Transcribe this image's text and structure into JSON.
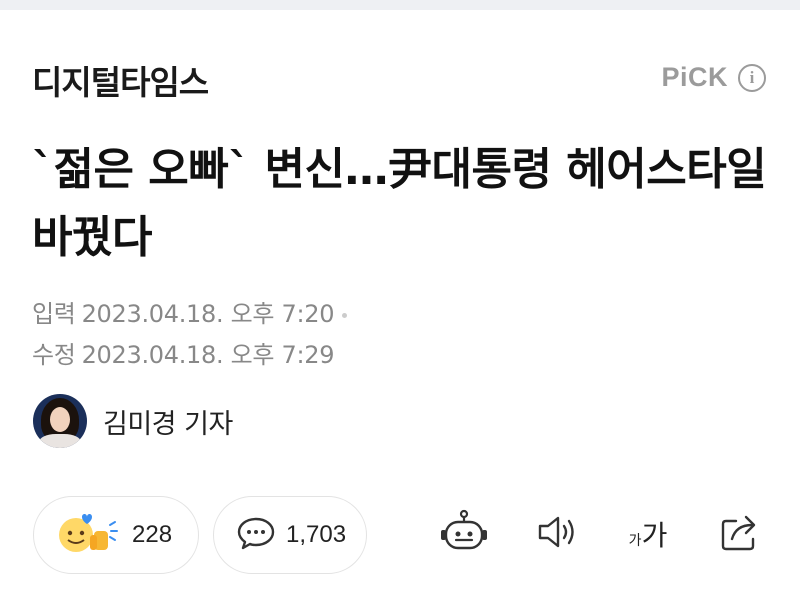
{
  "header": {
    "logo": "디지털타임스",
    "pick_label": "PiCK",
    "info_glyph": "i"
  },
  "article": {
    "title": "`젊은 오빠` 변신…尹대통령 헤어스타일 바꿨다",
    "published_label": "입력",
    "published": "2023.04.18. 오후 7:20",
    "modified_label": "수정",
    "modified": "2023.04.18. 오후 7:29"
  },
  "reporter": {
    "name": "김미경 기자"
  },
  "actions": {
    "reactions_count": "228",
    "comments_count": "1,703",
    "fontsize_small": "가",
    "fontsize_large": "가"
  },
  "icons": [
    "reaction-emoji-icon",
    "comment-icon",
    "robot-summary-icon",
    "speaker-icon",
    "font-size-icon",
    "share-icon"
  ],
  "colors": {
    "pick_gray": "#9b9b9b",
    "text": "#111111",
    "meta": "#888888",
    "topbar": "#eef0f3"
  }
}
